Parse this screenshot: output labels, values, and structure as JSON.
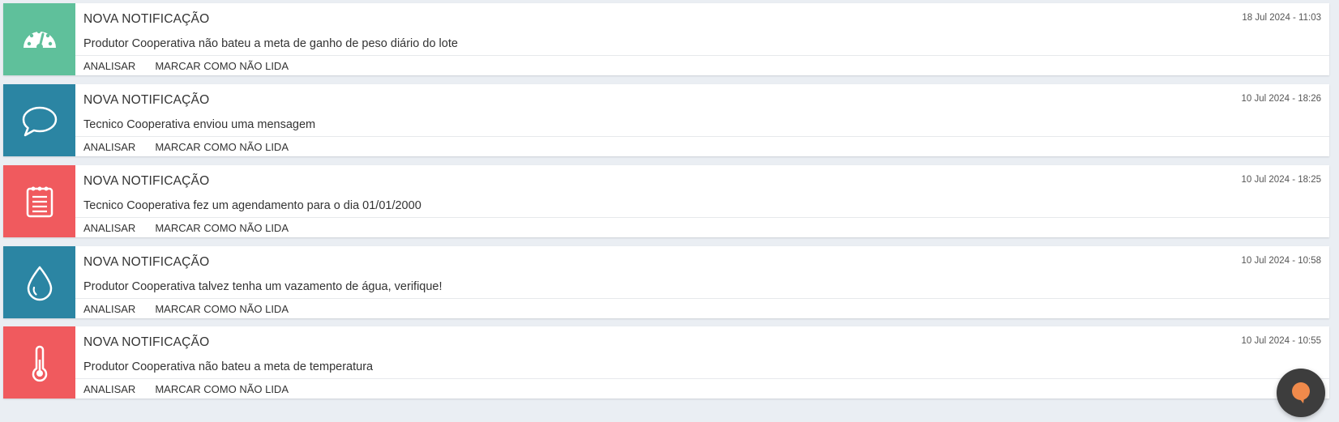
{
  "notifications": [
    {
      "title": "NOVA NOTIFICAÇÃO",
      "date": "18 Jul 2024 - 11:03",
      "message": "Produtor Cooperativa não bateu a meta de ganho de peso diário do lote",
      "icon": "speedometer-icon",
      "color": "#5fc09b",
      "actions": [
        "ANALISAR",
        "MARCAR COMO NÃO LIDA"
      ]
    },
    {
      "title": "NOVA NOTIFICAÇÃO",
      "date": "10 Jul 2024 - 18:26",
      "message": "Tecnico Cooperativa enviou uma mensagem",
      "icon": "chat-bubble-icon",
      "color": "#2b85a3",
      "actions": [
        "ANALISAR",
        "MARCAR COMO NÃO LIDA"
      ]
    },
    {
      "title": "NOVA NOTIFICAÇÃO",
      "date": "10 Jul 2024 - 18:25",
      "message": "Tecnico Cooperativa fez um agendamento para o dia 01/01/2000",
      "icon": "notepad-icon",
      "color": "#f05a5e",
      "actions": [
        "ANALISAR",
        "MARCAR COMO NÃO LIDA"
      ]
    },
    {
      "title": "NOVA NOTIFICAÇÃO",
      "date": "10 Jul 2024 - 10:58",
      "message": "Produtor Cooperativa talvez tenha um vazamento de água, verifique!",
      "icon": "water-drop-icon",
      "color": "#2b85a3",
      "actions": [
        "ANALISAR",
        "MARCAR COMO NÃO LIDA"
      ]
    },
    {
      "title": "NOVA NOTIFICAÇÃO",
      "date": "10 Jul 2024 - 10:55",
      "message": "Produtor Cooperativa não bateu a meta de temperatura",
      "icon": "thermometer-icon",
      "color": "#f05a5e",
      "actions": [
        "ANALISAR",
        "MARCAR COMO NÃO LIDA"
      ]
    }
  ],
  "chat_widget": {
    "icon": "chat-widget-icon",
    "bubble_color": "#f08a4b",
    "background": "#3d3d3d"
  }
}
